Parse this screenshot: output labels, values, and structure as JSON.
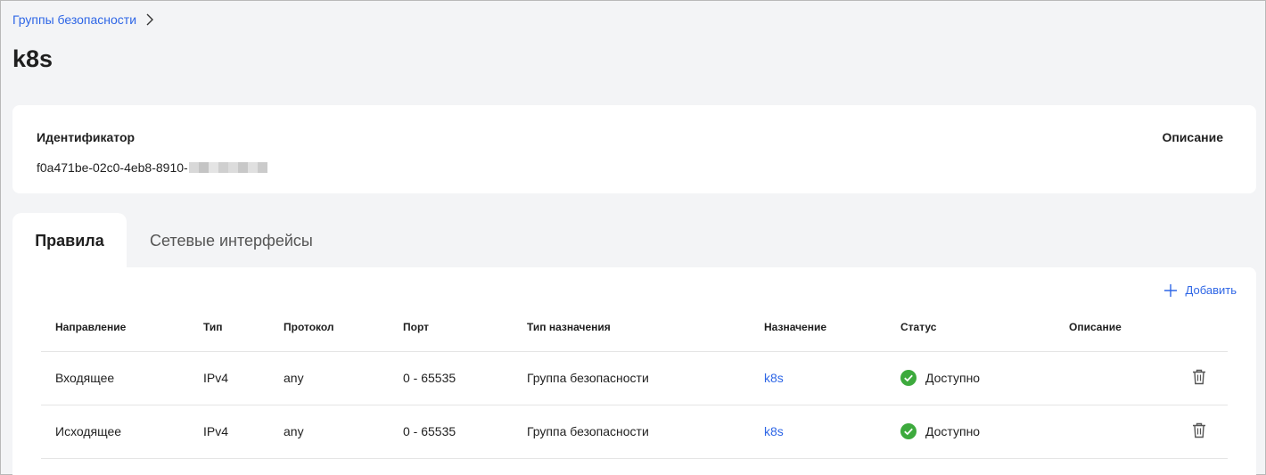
{
  "breadcrumb": {
    "parent": "Группы безопасности"
  },
  "page": {
    "title": "k8s"
  },
  "info": {
    "id_label": "Идентификатор",
    "id_value": "f0a471be-02c0-4eb8-8910-",
    "desc_label": "Описание"
  },
  "tabs": [
    {
      "label": "Правила",
      "active": true
    },
    {
      "label": "Сетевые интерфейсы",
      "active": false
    }
  ],
  "toolbar": {
    "add_label": "Добавить"
  },
  "table": {
    "headers": [
      "Направление",
      "Тип",
      "Протокол",
      "Порт",
      "Тип назначения",
      "Назначение",
      "Статус",
      "Описание"
    ],
    "rows": [
      {
        "direction": "Входящее",
        "type": "IPv4",
        "protocol": "any",
        "port": "0 - 65535",
        "dest_type": "Группа безопасности",
        "dest": "k8s",
        "status": "Доступно",
        "description": ""
      },
      {
        "direction": "Исходящее",
        "type": "IPv4",
        "protocol": "any",
        "port": "0 - 65535",
        "dest_type": "Группа безопасности",
        "dest": "k8s",
        "status": "Доступно",
        "description": ""
      }
    ]
  },
  "colors": {
    "accent": "#2e66e6",
    "success": "#3daa3d"
  }
}
